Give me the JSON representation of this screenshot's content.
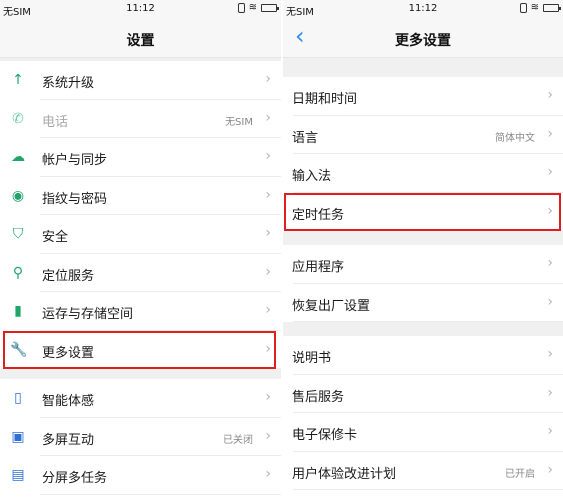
{
  "left": {
    "status": {
      "sim": "无SIM",
      "time": "11:12"
    },
    "title": "设置",
    "groups": [
      [
        {
          "icon": "arrow-up-icon",
          "glyph": "↑",
          "color": "#1fa56a",
          "label": "系统升级",
          "value": ""
        },
        {
          "icon": "phone-icon",
          "glyph": "✆",
          "color": "#6fc9a6",
          "label": "电话",
          "value": "无SIM",
          "dim": true
        },
        {
          "icon": "cloud-icon",
          "glyph": "☁",
          "color": "#1fa56a",
          "label": "帐户与同步",
          "value": ""
        },
        {
          "icon": "fingerprint-icon",
          "glyph": "◉",
          "color": "#1fa56a",
          "label": "指纹与密码",
          "value": ""
        },
        {
          "icon": "shield-icon",
          "glyph": "⛉",
          "color": "#1fa56a",
          "label": "安全",
          "value": ""
        },
        {
          "icon": "location-pin-icon",
          "glyph": "⚲",
          "color": "#1fa56a",
          "label": "定位服务",
          "value": ""
        },
        {
          "icon": "storage-card-icon",
          "glyph": "▮",
          "color": "#1fa56a",
          "label": "运存与存储空间",
          "value": ""
        },
        {
          "icon": "wrench-icon",
          "glyph": "🔧",
          "color": "#2f6fd6",
          "label": "更多设置",
          "value": "",
          "highlight": true
        }
      ],
      [
        {
          "icon": "smart-motion-icon",
          "glyph": "▯",
          "color": "#2f6fd6",
          "label": "智能体感",
          "value": ""
        },
        {
          "icon": "multi-screen-icon",
          "glyph": "▣",
          "color": "#2f6fd6",
          "label": "多屏互动",
          "value": "已关闭"
        },
        {
          "icon": "split-screen-icon",
          "glyph": "▤",
          "color": "#2f6fd6",
          "label": "分屏多任务",
          "value": ""
        }
      ]
    ]
  },
  "right": {
    "status": {
      "sim": "无SIM",
      "time": "11:12"
    },
    "title": "更多设置",
    "back_icon": "‹",
    "groups": [
      [
        {
          "label": "日期和时间",
          "value": ""
        },
        {
          "label": "语言",
          "value": "简体中文"
        },
        {
          "label": "输入法",
          "value": ""
        },
        {
          "label": "定时任务",
          "value": "",
          "highlight": true
        }
      ],
      [
        {
          "label": "应用程序",
          "value": ""
        },
        {
          "label": "恢复出厂设置",
          "value": ""
        }
      ],
      [
        {
          "label": "说明书",
          "value": ""
        },
        {
          "label": "售后服务",
          "value": ""
        },
        {
          "label": "电子保修卡",
          "value": ""
        },
        {
          "label": "用户体验改进计划",
          "value": "已开启"
        }
      ]
    ]
  },
  "chevron": "›",
  "wifi_glyph": "≋",
  "highlight_color": "#e01e1e"
}
